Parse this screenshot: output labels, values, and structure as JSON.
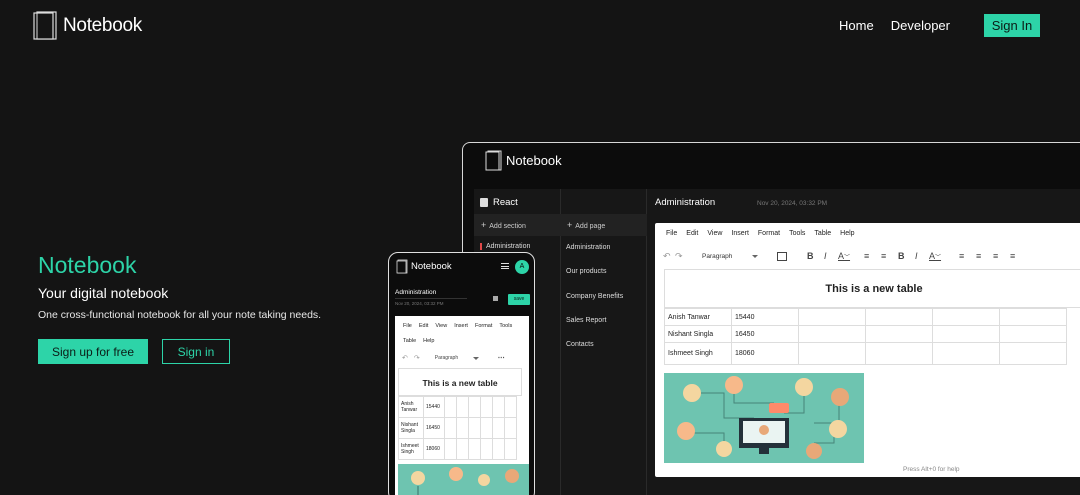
{
  "brand": {
    "name": "Notebook",
    "icon": "notebook-icon"
  },
  "nav": {
    "home": "Home",
    "developer": "Developer",
    "sign_in": "Sign In"
  },
  "hero": {
    "title": "Notebook",
    "subtitle": "Your digital notebook",
    "description": "One cross-functional notebook for all your note taking needs.",
    "signup_button": "Sign up for free",
    "signin_button": "Sign in"
  },
  "colors": {
    "accent": "#2dd4a8",
    "background": "#141414",
    "section_marker": "#e04848"
  },
  "desktop_preview": {
    "brand": "Notebook",
    "notebook_name": "React",
    "add_section": "Add section",
    "sections": [
      "Administration"
    ],
    "add_page": "Add page",
    "pages": [
      "Administration",
      "Our products",
      "Company Benefits",
      "Sales Report",
      "Contacts"
    ],
    "page_title": "Administration",
    "page_date": "Nov 20, 2024, 03:32 PM",
    "editor_menu": [
      "File",
      "Edit",
      "View",
      "Insert",
      "Format",
      "Tools",
      "Table",
      "Help"
    ],
    "block_format": "Paragraph",
    "table_title": "This is a new table",
    "table_rows": [
      [
        "Anish Tanwar",
        "15440"
      ],
      [
        "Nishant Singla",
        "16450"
      ],
      [
        "Ishmeet Singh",
        "18060"
      ]
    ],
    "help_text": "Press Alt+0 for help"
  },
  "mobile_preview": {
    "brand": "Notebook",
    "avatar_initial": "A",
    "page_title": "Administration",
    "page_date": "Nov 20, 2024, 03:32 PM",
    "save_label": "save",
    "editor_menu_row1": [
      "File",
      "Edit",
      "View",
      "Insert",
      "Format",
      "Tools"
    ],
    "editor_menu_row2": [
      "Table",
      "Help"
    ],
    "block_format": "Paragraph",
    "table_title": "This is a new table",
    "table_rows": [
      [
        "Anish Tanwar",
        "15440"
      ],
      [
        "Nishant Singla",
        "16450"
      ],
      [
        "Ishmeet Singh",
        "18060"
      ]
    ]
  }
}
